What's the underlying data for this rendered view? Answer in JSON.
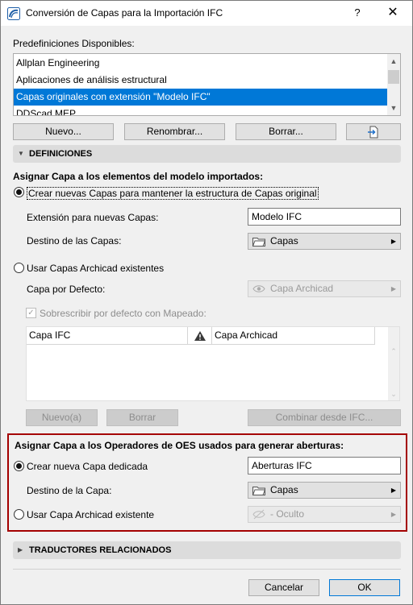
{
  "window": {
    "title": "Conversión de Capas para la Importación IFC",
    "help_label": "?",
    "close_label": "✕"
  },
  "presets": {
    "label": "Predefiniciones Disponibles:",
    "items": [
      "Allplan Engineering",
      "Aplicaciones de análisis estructural",
      "Capas originales con extensión \"Modelo IFC\"",
      "DDScad MEP"
    ],
    "selected_index": 2,
    "buttons": {
      "new": "Nuevo...",
      "rename": "Renombrar...",
      "delete": "Borrar..."
    }
  },
  "definitions": {
    "header": "DEFINICIONES",
    "assign_label": "Asignar Capa a los elementos del modelo importados:",
    "create_new_radio": "Crear nuevas Capas para mantener la estructura de Capas original",
    "extension_label": "Extensión para nuevas Capas:",
    "extension_value": "Modelo IFC",
    "destination_label": "Destino de las Capas:",
    "destination_value": "Capas",
    "use_existing_radio": "Usar Capas Archicad existentes",
    "default_layer_label": "Capa por Defecto:",
    "default_layer_value": "Capa Archicad",
    "overwrite_checkbox": "Sobrescribir por defecto con Mapeado:",
    "table": {
      "col_ifc": "Capa IFC",
      "col_archicad": "Capa Archicad"
    },
    "buttons": {
      "new": "Nuevo(a)",
      "delete": "Borrar",
      "combine": "Combinar desde IFC..."
    }
  },
  "openings": {
    "label": "Asignar Capa a los Operadores de OES usados para generar aberturas:",
    "create_radio": "Crear nueva Capa dedicada",
    "create_value": "Aberturas IFC",
    "destination_label": "Destino de la Capa:",
    "destination_value": "Capas",
    "use_existing_radio": "Usar Capa Archicad existente",
    "existing_value": "- Oculto"
  },
  "related": {
    "header": "TRADUCTORES RELACIONADOS"
  },
  "footer": {
    "cancel": "Cancelar",
    "ok": "OK"
  },
  "colors": {
    "selection": "#0078d7",
    "highlight_box": "#a40000"
  }
}
